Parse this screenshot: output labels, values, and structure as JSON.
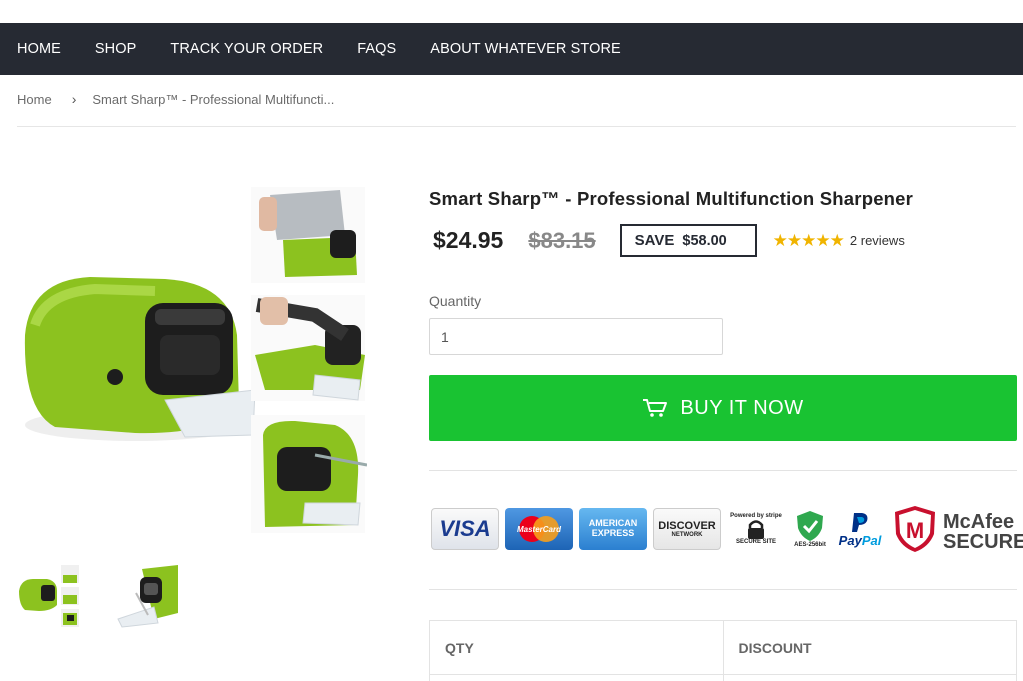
{
  "nav": {
    "items": [
      "HOME",
      "SHOP",
      "TRACK YOUR ORDER",
      "FAQS",
      "ABOUT WHATEVER STORE"
    ]
  },
  "breadcrumb": {
    "home": "Home",
    "current": "Smart Sharp™ - Professional Multifuncti..."
  },
  "product": {
    "title": "Smart Sharp™ - Professional Multifunction Sharpener",
    "price": "$24.95",
    "compare_price": "$83.15",
    "save_label": "SAVE",
    "save_amount": "$58.00",
    "rating": 5,
    "reviews": "2 reviews",
    "quantity_label": "Quantity",
    "quantity_value": "1",
    "buy_label": "BUY IT NOW"
  },
  "payments": {
    "visa": "VISA",
    "mastercard": "MasterCard",
    "amex_line1": "AMERICAN",
    "amex_line2": "EXPRESS",
    "discover": "DISCOVER",
    "discover_sub": "NETWORK",
    "stripe_top": "Powered by stripe",
    "stripe_bottom": "SECURE SITE",
    "aes": "AES-256bit",
    "paypal_1": "Pay",
    "paypal_2": "Pal",
    "mcafee_1": "McAfee",
    "mcafee_2": "SECURE"
  },
  "discount_table": {
    "headers": [
      "QTY",
      "DISCOUNT"
    ]
  },
  "colors": {
    "nav_bg": "#262a33",
    "buy_button": "#19c332",
    "star": "#f0b400",
    "product_green": "#8cc21f"
  }
}
